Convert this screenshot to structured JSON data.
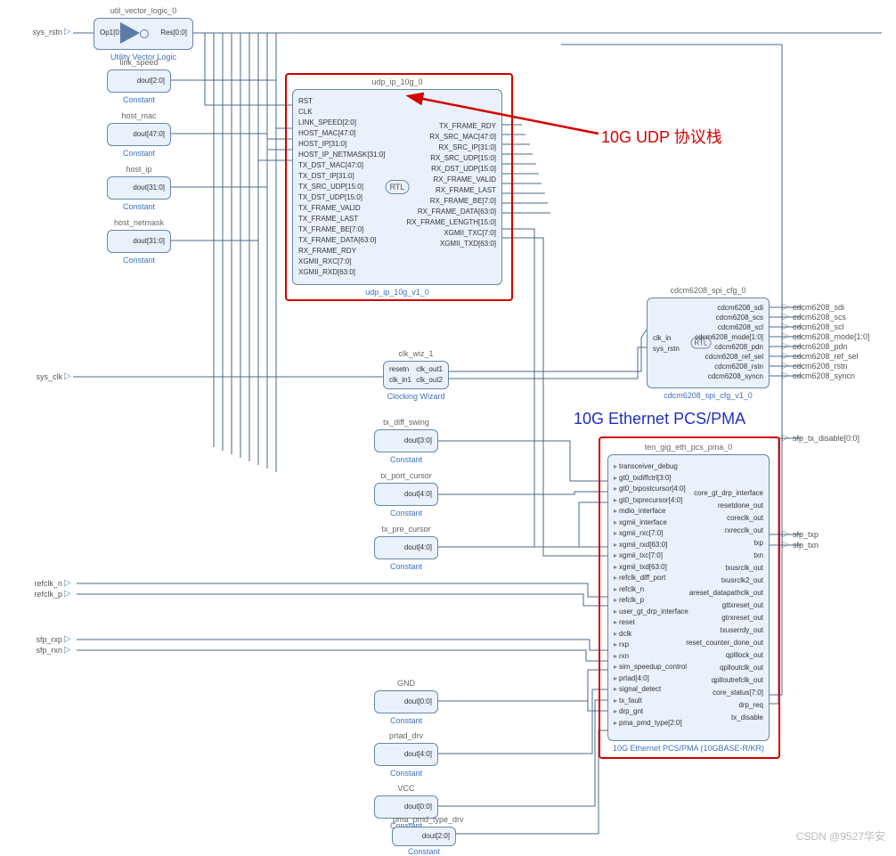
{
  "annotations": {
    "udp": "10G UDP 协议栈",
    "pcs": "10G Ethernet PCS/PMA",
    "watermark": "CSDN @9527华安"
  },
  "ext_left": {
    "sys_rstn": "sys_rstn",
    "sys_clk": "sys_clk",
    "refclk_n": "refclk_n",
    "refclk_p": "refclk_p",
    "sfp_rxp": "sfp_rxp",
    "sfp_rxn": "sfp_rxn"
  },
  "ext_right": {
    "cdcm6208_sdi": "cdcm6208_sdi",
    "cdcm6208_scs": "cdcm6208_scs",
    "cdcm6208_scl": "cdcm6208_scl",
    "cdcm6208_mode": "cdcm6208_mode[1:0]",
    "cdcm6208_pdn": "cdcm6208_pdn",
    "cdcm6208_ref_sel": "cdcm6208_ref_sel",
    "cdcm6208_rstn": "cdcm6208_rstn",
    "cdcm6208_syncn": "cdcm6208_syncn",
    "sfp_tx_disable": "sfp_tx_disable[0:0]",
    "sfp_txp": "sfp_txp",
    "sfp_txn": "sfp_txn"
  },
  "util_vector_logic": {
    "title": "util_vector_logic_0",
    "footer": "Utility Vector Logic",
    "in": "Op1[0:0]",
    "out": "Res[0:0]"
  },
  "constants": {
    "link_speed": {
      "title": "link_speed",
      "port": "dout[2:0]",
      "footer": "Constant"
    },
    "host_mac": {
      "title": "host_mac",
      "port": "dout[47:0]",
      "footer": "Constant"
    },
    "host_ip": {
      "title": "host_ip",
      "port": "dout[31:0]",
      "footer": "Constant"
    },
    "host_netmask": {
      "title": "host_netmask",
      "port": "dout[31:0]",
      "footer": "Constant"
    },
    "tx_diff_swing": {
      "title": "tx_diff_swing",
      "port": "dout[3:0]",
      "footer": "Constant"
    },
    "tx_port_cursor": {
      "title": "tx_port_cursor",
      "port": "dout[4:0]",
      "footer": "Constant"
    },
    "tx_pre_cursor": {
      "title": "tx_pre_cursor",
      "port": "dout[4:0]",
      "footer": "Constant"
    },
    "GND": {
      "title": "GND",
      "port": "dout[0:0]",
      "footer": "Constant"
    },
    "prtad_drv": {
      "title": "prtad_drv",
      "port": "dout[4:0]",
      "footer": "Constant"
    },
    "VCC": {
      "title": "VCC",
      "port": "dout[0:0]",
      "footer": "Constant"
    },
    "pma_pmd_type_drv": {
      "title": "pma_pmd_type_drv",
      "port": "dout[2:0]",
      "footer": "Constant"
    }
  },
  "clk_wiz": {
    "title": "clk_wiz_1",
    "footer": "Clocking Wizard",
    "left": [
      "resetn",
      "clk_in1"
    ],
    "right": [
      "clk_out1",
      "clk_out2"
    ]
  },
  "udp_ip": {
    "title": "udp_ip_10g_0",
    "footer": "udp_ip_10g_v1_0",
    "badge": "RTL",
    "left": [
      "RST",
      "CLK",
      "LINK_SPEED[2:0]",
      "HOST_MAC[47:0]",
      "HOST_IP[31:0]",
      "HOST_IP_NETMASK[31:0]",
      "TX_DST_MAC[47:0]",
      "TX_DST_IP[31:0]",
      "TX_SRC_UDP[15:0]",
      "TX_DST_UDP[15:0]",
      "TX_FRAME_VALID",
      "TX_FRAME_LAST",
      "TX_FRAME_BE[7:0]",
      "TX_FRAME_DATA[63:0]",
      "RX_FRAME_RDY",
      "XGMII_RXC[7:0]",
      "XGMII_RXD[63:0]"
    ],
    "right": [
      "TX_FRAME_RDY",
      "RX_SRC_MAC[47:0]",
      "RX_SRC_IP[31:0]",
      "RX_SRC_UDP[15:0]",
      "RX_DST_UDP[15:0]",
      "RX_FRAME_VALID",
      "RX_FRAME_LAST",
      "RX_FRAME_BE[7:0]",
      "RX_FRAME_DATA[63:0]",
      "RX_FRAME_LENGTH[15:0]",
      "XGMII_TXC[7:0]",
      "XGMII_TXD[63:0]"
    ]
  },
  "cdcm6208": {
    "title": "cdcm6208_spi_cfg_0",
    "footer": "cdcm6208_spi_cfg_v1_0",
    "badge": "RTL",
    "left": [
      "clk_in",
      "sys_rstn"
    ],
    "right": [
      "cdcm6208_sdi",
      "cdcm6208_scs",
      "cdcm6208_scl",
      "cdcm6208_mode[1:0]",
      "cdcm6208_pdn",
      "cdcm6208_ref_sel",
      "cdcm6208_rstn",
      "cdcm6208_syncn"
    ]
  },
  "pcs_pma": {
    "title": "ten_gig_eth_pcs_pma_0",
    "footer": "10G Ethernet PCS/PMA (10GBASE-R/KR)",
    "left": [
      "transceiver_debug",
      "gt0_txdiffctrl[3:0]",
      "gt0_txpostcursor[4:0]",
      "gt0_txprecursor[4:0]",
      "mdio_interface",
      "xgmii_interface",
      "xgmii_rxc[7:0]",
      "xgmii_rxd[63:0]",
      "xgmii_txc[7:0]",
      "xgmii_txd[63:0]",
      "refclk_diff_port",
      "refclk_n",
      "refclk_p",
      "user_gt_drp_interface",
      "reset",
      "dclk",
      "rxp",
      "rxn",
      "sim_speedup_control",
      "prtad[4:0]",
      "signal_detect",
      "tx_fault",
      "drp_gnt",
      "pma_pmd_type[2:0]"
    ],
    "right": [
      "core_gt_drp_interface",
      "resetdone_out",
      "coreclk_out",
      "rxrecclk_out",
      "txp",
      "txn",
      "txusrclk_out",
      "txusrclk2_out",
      "areset_datapathclk_out",
      "gttxreset_out",
      "gtrxreset_out",
      "txuserrdy_out",
      "reset_counter_done_out",
      "qplllock_out",
      "qplloutclk_out",
      "qplloutrefclk_out",
      "core_status[7:0]",
      "drp_req",
      "tx_disable"
    ]
  }
}
